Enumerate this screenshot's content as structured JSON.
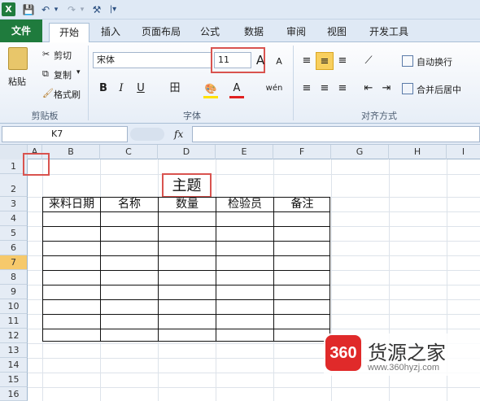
{
  "app": {
    "logo_letter": "X"
  },
  "qat": {
    "save": "💾",
    "undo": "↶",
    "undo_menu": "▾",
    "redo": "↷",
    "redo_menu": "▾",
    "paint": "⚒",
    "custom_menu": "|▾"
  },
  "tabs": [
    "文件",
    "开始",
    "插入",
    "页面布局",
    "公式",
    "数据",
    "审阅",
    "视图",
    "开发工具"
  ],
  "ribbon": {
    "clipboard": {
      "paste": "粘贴",
      "cut": "剪切",
      "copy": "复制",
      "copy_menu": "▾",
      "format_painter": "格式刷",
      "label": "剪贴板"
    },
    "font": {
      "font_name": "宋体",
      "font_size": "11",
      "grow": "A",
      "shrink": "A",
      "bold": "B",
      "italic": "I",
      "underline": "U",
      "border": "田",
      "fill": "🎨",
      "font_color": "A",
      "wen": "wén",
      "label": "字体"
    },
    "alignment": {
      "wrap": "自动换行",
      "merge": "合并后居中",
      "label": "对齐方式"
    }
  },
  "formula_bar": {
    "name_box": "K7",
    "fx": "fx"
  },
  "columns": [
    "A",
    "B",
    "C",
    "D",
    "E",
    "F",
    "G",
    "H",
    "I"
  ],
  "rows": [
    "1",
    "2",
    "3",
    "4",
    "5",
    "6",
    "7",
    "8",
    "9",
    "10",
    "11",
    "12",
    "13",
    "14",
    "15",
    "16"
  ],
  "active_row": "7",
  "sheet": {
    "title": "主题",
    "headers": [
      "来料日期",
      "名称",
      "数量",
      "检验员",
      "备注"
    ]
  },
  "watermark": {
    "logo": "360",
    "title": "货源之家",
    "url": "www.360hyzj.com"
  },
  "colors": {
    "accent": "#1f7b3d",
    "highlight": "#d9534f"
  }
}
